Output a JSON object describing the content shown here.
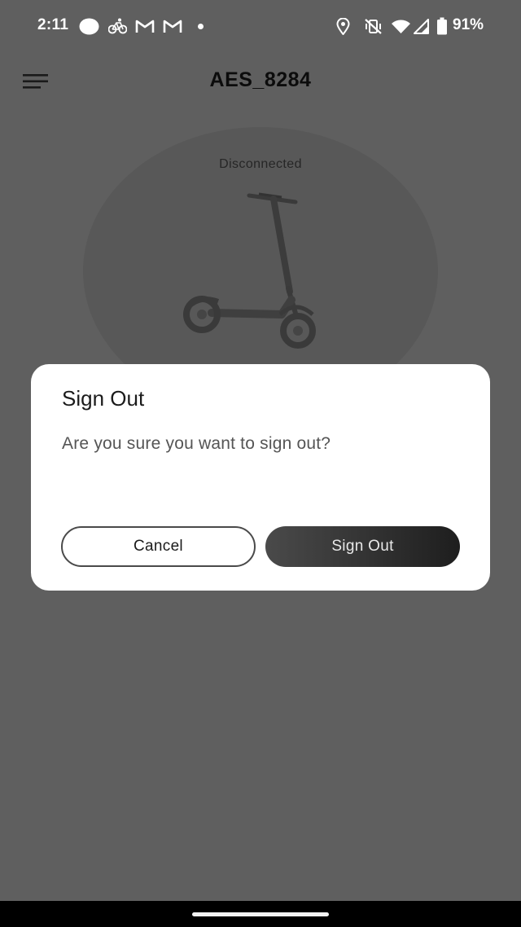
{
  "status_bar": {
    "time": "2:11",
    "battery_percent": "91%",
    "left_icons": [
      "circle-notification-icon",
      "bicycle-icon",
      "gmail-icon",
      "gmail-icon",
      "dot-icon"
    ],
    "right_icons": [
      "location-icon",
      "vibrate-off-icon",
      "wifi-icon",
      "signal-icon",
      "battery-icon"
    ]
  },
  "app_bar": {
    "title": "AES_8284",
    "menu_icon": "hamburger-menu-icon"
  },
  "device": {
    "connection_status": "Disconnected",
    "image": "electric-scooter"
  },
  "dialog": {
    "title": "Sign Out",
    "message": "Are you sure you want to sign out?",
    "cancel_label": "Cancel",
    "confirm_label": "Sign Out"
  },
  "colors": {
    "scrim_background": "#5f5f5f",
    "dialog_background": "#ffffff",
    "confirm_gradient_start": "#4a4a4a",
    "confirm_gradient_end": "#1e1e1e"
  }
}
